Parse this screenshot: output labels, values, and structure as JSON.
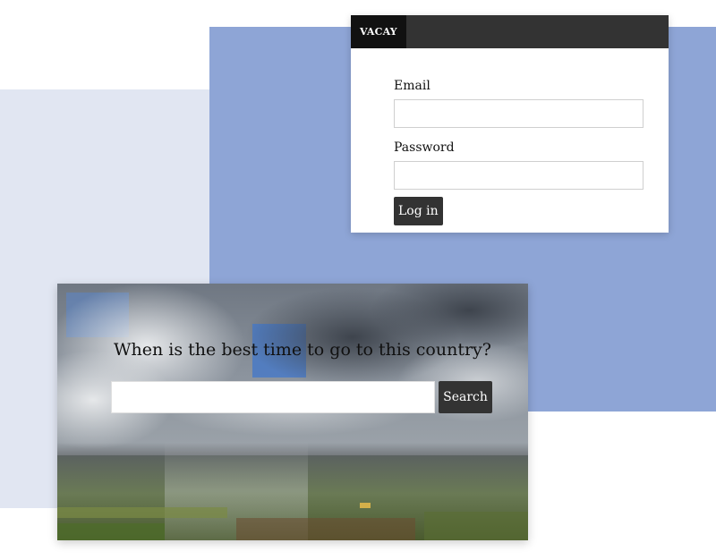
{
  "login": {
    "brand": "VACAY",
    "email_label": "Email",
    "email_value": "",
    "password_label": "Password",
    "password_value": "",
    "login_button": "Log in"
  },
  "hero": {
    "question": "When is the best time to go to this country?",
    "search_value": "",
    "search_button": "Search"
  },
  "colors": {
    "bg_light": "#e1e6f2",
    "bg_blue": "#8ea5d6",
    "header_dark": "#333333",
    "brand_dark": "#111111",
    "button_dark": "#333333"
  }
}
